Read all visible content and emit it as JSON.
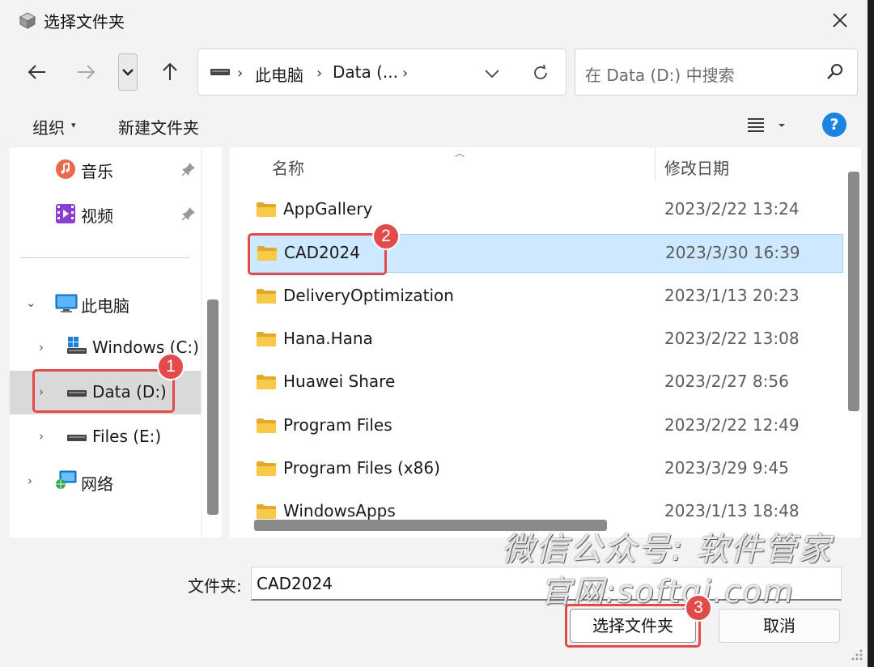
{
  "window": {
    "title": "选择文件夹"
  },
  "nav": {
    "address": {
      "segments": [
        "此电脑",
        "Data (..."
      ]
    },
    "search_placeholder": "在 Data (D:) 中搜索"
  },
  "toolbar": {
    "organize_label": "组织",
    "new_folder_label": "新建文件夹",
    "help_label": "?"
  },
  "sidebar": {
    "quick": [
      {
        "label": "音乐",
        "icon": "music-icon",
        "pinned": true
      },
      {
        "label": "视频",
        "icon": "video-icon",
        "pinned": true
      }
    ],
    "this_pc": {
      "label": "此电脑",
      "expanded": true
    },
    "drives": [
      {
        "label": "Windows (C:)",
        "icon": "windows-drive-icon"
      },
      {
        "label": "Data (D:)",
        "icon": "drive-icon",
        "selected": true
      },
      {
        "label": "Files (E:)",
        "icon": "drive-icon"
      }
    ],
    "network": {
      "label": "网络"
    }
  },
  "file_list": {
    "columns": {
      "name": "名称",
      "modified": "修改日期"
    },
    "rows": [
      {
        "name": "AppGallery",
        "modified": "2023/2/22 13:24"
      },
      {
        "name": "CAD2024",
        "modified": "2023/3/30 16:39",
        "selected": true
      },
      {
        "name": "DeliveryOptimization",
        "modified": "2023/1/13 20:23"
      },
      {
        "name": "Hana.Hana",
        "modified": "2023/2/22 13:08"
      },
      {
        "name": "Huawei Share",
        "modified": "2023/2/27 8:56"
      },
      {
        "name": "Program Files",
        "modified": "2023/2/22 12:49"
      },
      {
        "name": "Program Files (x86)",
        "modified": "2023/3/29 9:45"
      },
      {
        "name": "WindowsApps",
        "modified": "2023/1/13 18:48"
      }
    ]
  },
  "footer": {
    "folder_label": "文件夹:",
    "folder_value": "CAD2024",
    "select_label": "选择文件夹",
    "cancel_label": "取消"
  },
  "annotations": {
    "step1": "1",
    "step2": "2",
    "step3": "3"
  },
  "watermark": {
    "line1": "微信公众号: 软件管家",
    "line2": "官网:softgj.com"
  },
  "colors": {
    "accent": "#1b84e0",
    "selection": "#cde8ff",
    "annotation": "#e34b4b",
    "folder": "#f8c847"
  }
}
